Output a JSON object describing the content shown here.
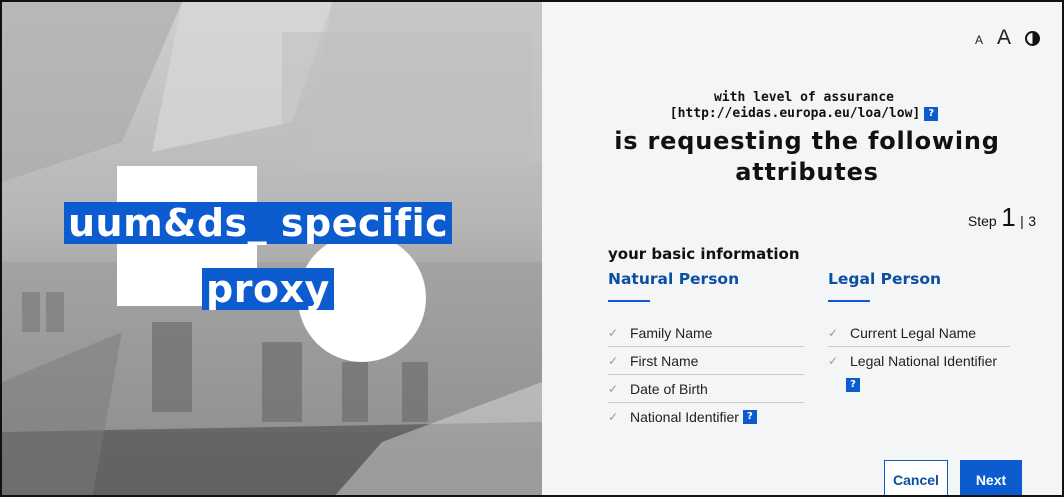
{
  "hero": {
    "brand_line1": "uum&ds_ specific",
    "brand_line2": "proxy"
  },
  "toolbar": {
    "font_small_label": "A",
    "font_large_label": "A",
    "contrast_icon": "contrast-icon"
  },
  "header": {
    "loa_line1": "with level of assurance",
    "loa_line2": "[http://eidas.europa.eu/loa/low]",
    "help_glyph": "?",
    "title_line1": "is requesting the following",
    "title_line2": "attributes"
  },
  "step": {
    "label": "Step",
    "current": "1",
    "separator": "|",
    "total": "3"
  },
  "section": {
    "title": "your basic information"
  },
  "natural_person": {
    "title": "Natural Person",
    "attributes": [
      "Family Name",
      "First Name",
      "Date of Birth",
      "National Identifier"
    ]
  },
  "legal_person": {
    "title": "Legal Person",
    "attributes": [
      "Current Legal Name",
      "Legal National Identifier"
    ]
  },
  "actions": {
    "cancel_label": "Cancel",
    "next_label": "Next"
  },
  "colors": {
    "accent": "#0c5cd0",
    "heading_blue": "#0b4ea2",
    "panel_bg": "#f4f5f7"
  }
}
